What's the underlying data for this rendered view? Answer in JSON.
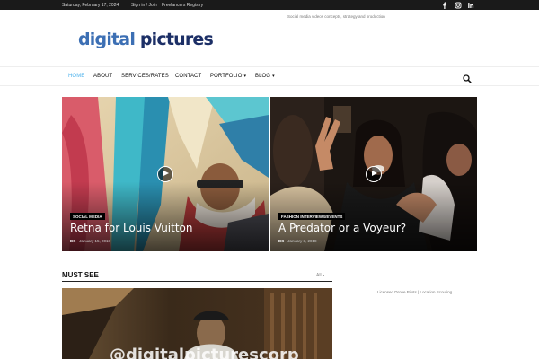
{
  "topbar": {
    "date": "Saturday, February 17, 2024",
    "signin": "Sign in / Join",
    "registry": "Freelancers Registry",
    "social": [
      "facebook-icon",
      "instagram-icon",
      "linkedin-icon"
    ]
  },
  "header": {
    "tagline": "Social media videos concepts, strategy and production",
    "logo_part1": "digital",
    "logo_part2": "pictures"
  },
  "nav": {
    "items": [
      {
        "label": "HOME"
      },
      {
        "label": "ABOUT"
      },
      {
        "label": "SERVICES/RATES"
      },
      {
        "label": "CONTACT"
      },
      {
        "label": "PORTFOLIO"
      },
      {
        "label": "BLOG"
      }
    ],
    "search_icon": "search-icon"
  },
  "featured": [
    {
      "category": "SOCIAL MEDIA",
      "title": "Retna for Louis Vuitton",
      "author": "DS",
      "date": "January 15, 2018"
    },
    {
      "category": "FASHION INTERVIEWS/EVENTS",
      "title": "A Predator or a Voyeur?",
      "author": "DS",
      "date": "January 3, 2018"
    }
  ],
  "must_see": {
    "heading": "MUST SEE",
    "filter": "All",
    "overlay_text": "@digitalpicturescorp"
  },
  "sidebar": {
    "ad_text": "Licensed Drone Pilots | Location Scouting"
  },
  "colors": {
    "accent": "#4db2ec",
    "logo_light": "#3c6fb4",
    "logo_dark": "#1c2f66"
  }
}
